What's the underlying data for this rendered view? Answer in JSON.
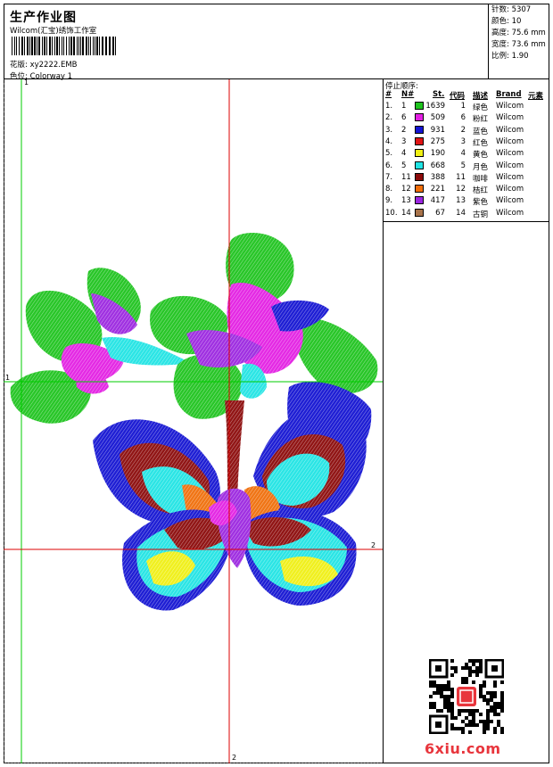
{
  "header": {
    "title": "生产作业图",
    "studio": "Wilcom(汇宝)绣饰工作室",
    "design_label": "花版:",
    "design_value": "xy2222.EMB",
    "colorway_label": "色位:",
    "colorway_value": "Colorway 1"
  },
  "stats": [
    {
      "label": "针数:",
      "value": "5307"
    },
    {
      "label": "颜色:",
      "value": "10"
    },
    {
      "label": "高度:",
      "value": "75.6 mm"
    },
    {
      "label": "宽度:",
      "value": "73.6 mm"
    },
    {
      "label": "比例:",
      "value": "1.90"
    }
  ],
  "guides": {
    "v_left": "1",
    "h_top": "1",
    "h_bottom": "2",
    "v_right": "2"
  },
  "stop_sequence": {
    "title": "停止顺序:",
    "headers": [
      "#",
      "N#",
      "St.",
      "代码",
      "描述",
      "Brand",
      "元素"
    ],
    "rows": [
      {
        "idx": "1.",
        "n": "1",
        "st": "1639",
        "code": "1",
        "desc": "绿色",
        "brand": "Wilcom",
        "color": "#1ec31e"
      },
      {
        "idx": "2.",
        "n": "6",
        "st": "509",
        "code": "6",
        "desc": "粉红",
        "brand": "Wilcom",
        "color": "#e31fe3"
      },
      {
        "idx": "3.",
        "n": "2",
        "st": "931",
        "code": "2",
        "desc": "蓝色",
        "brand": "Wilcom",
        "color": "#1414d2"
      },
      {
        "idx": "4.",
        "n": "3",
        "st": "275",
        "code": "3",
        "desc": "红色",
        "brand": "Wilcom",
        "color": "#e01414"
      },
      {
        "idx": "5.",
        "n": "4",
        "st": "190",
        "code": "4",
        "desc": "黄色",
        "brand": "Wilcom",
        "color": "#f0f014"
      },
      {
        "idx": "6.",
        "n": "5",
        "st": "668",
        "code": "5",
        "desc": "月色",
        "brand": "Wilcom",
        "color": "#20e4e4"
      },
      {
        "idx": "7.",
        "n": "11",
        "st": "388",
        "code": "11",
        "desc": "咖啡",
        "brand": "Wilcom",
        "color": "#8c0a0a"
      },
      {
        "idx": "8.",
        "n": "12",
        "st": "221",
        "code": "12",
        "desc": "桔红",
        "brand": "Wilcom",
        "color": "#f06e0a"
      },
      {
        "idx": "9.",
        "n": "13",
        "st": "417",
        "code": "13",
        "desc": "紫色",
        "brand": "Wilcom",
        "color": "#9b26e0"
      },
      {
        "idx": "10.",
        "n": "14",
        "st": "67",
        "code": "14",
        "desc": "古铜",
        "brand": "Wilcom",
        "color": "#a8734a"
      }
    ]
  },
  "footer": {
    "site": "6xiu.com"
  },
  "colors": {
    "guide_green": "#00cc00",
    "guide_red": "#dd0000"
  }
}
